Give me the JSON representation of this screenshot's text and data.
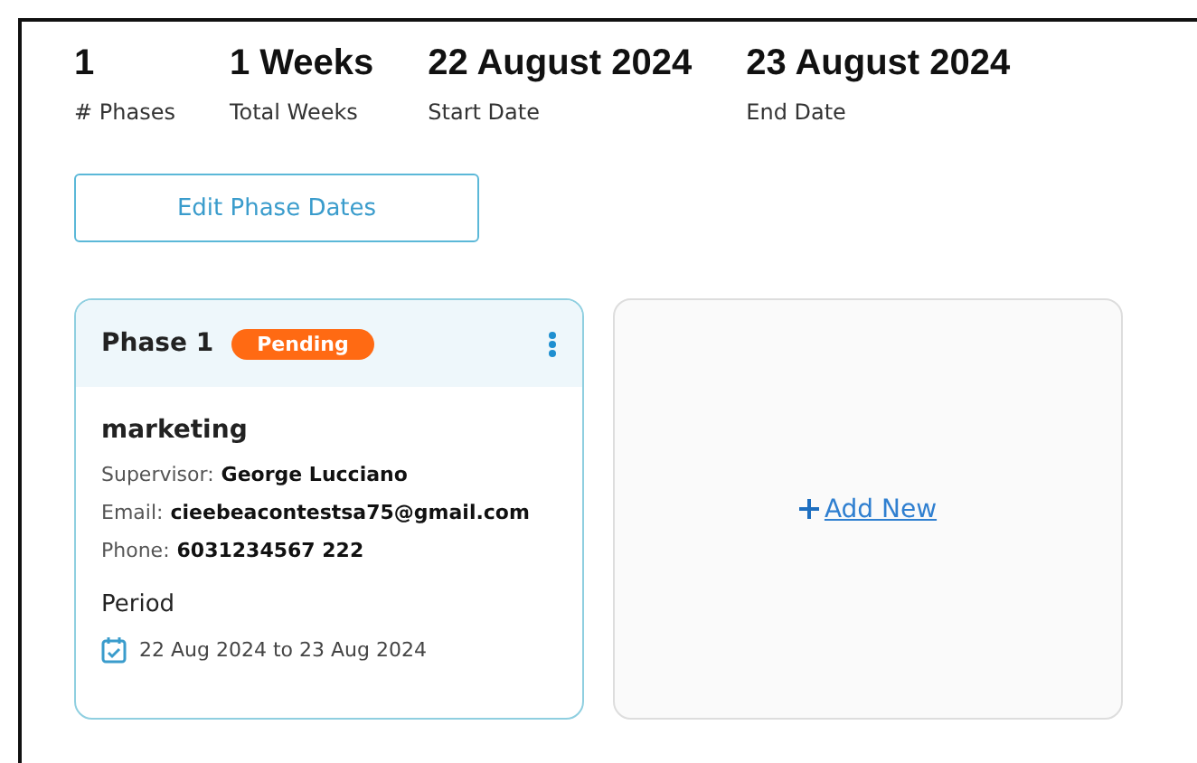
{
  "stats": [
    {
      "value": "1",
      "label": "# Phases"
    },
    {
      "value": "1 Weeks",
      "label": "Total Weeks"
    },
    {
      "value": "22 August 2024",
      "label": "Start Date"
    },
    {
      "value": "23 August 2024",
      "label": "End Date"
    }
  ],
  "edit_button": "Edit Phase Dates",
  "phases": [
    {
      "title": "Phase 1",
      "status": "Pending",
      "department": "marketing",
      "fields": [
        {
          "label": "Supervisor:",
          "value": "George Lucciano"
        },
        {
          "label": "Email:",
          "value": "cieebeacontestsa75@gmail.com"
        },
        {
          "label": "Phone:",
          "value": "6031234567 222"
        }
      ],
      "period_heading": "Period",
      "period": "22 Aug 2024 to 23 Aug 2024"
    }
  ],
  "add_new": "Add New"
}
